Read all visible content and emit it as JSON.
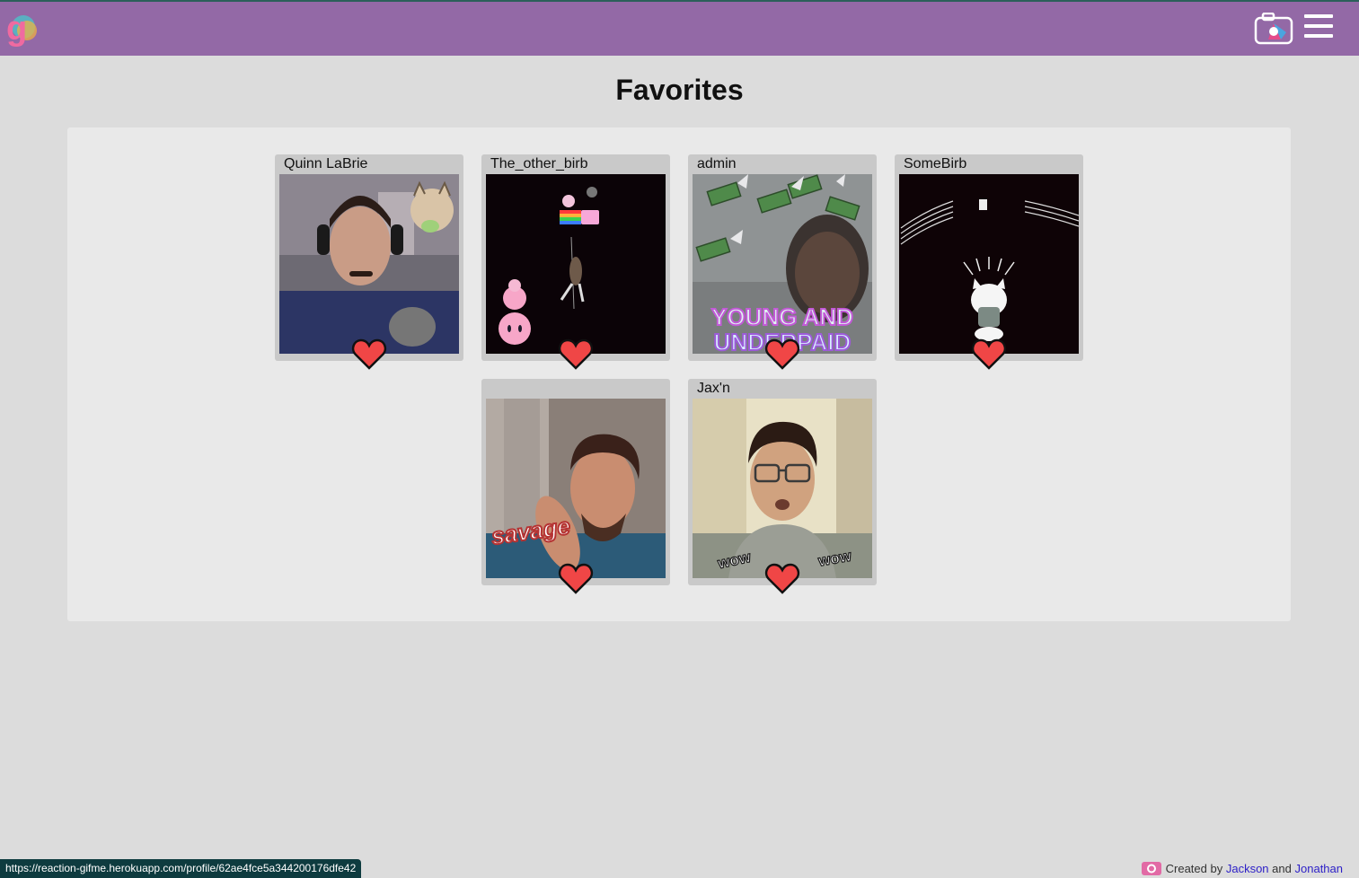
{
  "header": {
    "logo_icon": "gifme-logo-icon",
    "camera_icon": "camera-icon",
    "menu_icon": "hamburger-menu-icon",
    "color": "#9369a6"
  },
  "page": {
    "title": "Favorites"
  },
  "favorites": [
    {
      "username": "Quinn LaBrie",
      "media": "webcam-gif",
      "favorited": true
    },
    {
      "username": "The_other_birb",
      "media": "nyan-cat-gif",
      "favorited": true
    },
    {
      "username": "admin",
      "media": "flying-money-gif",
      "overlay_text": "YOUNG AND UNDERPAID",
      "favorited": true
    },
    {
      "username": "SomeBirb",
      "media": "dancing-cat-gif",
      "favorited": true
    },
    {
      "username": "",
      "media": "savage-gif",
      "overlay_text": "savage",
      "favorited": true
    },
    {
      "username": "Jax'n",
      "media": "wow-gif",
      "overlay_text": "wow",
      "favorited": true
    }
  ],
  "status_url": "https://reaction-gifme.herokuapp.com/profile/62ae4fce5a344200176dfe42",
  "footer": {
    "prefix": "Created by",
    "author1": "Jackson",
    "joiner": "and",
    "author2": "Jonathan",
    "icon": "github-icon"
  },
  "colors": {
    "heart": "#f04646",
    "link": "#2c1fc7"
  }
}
